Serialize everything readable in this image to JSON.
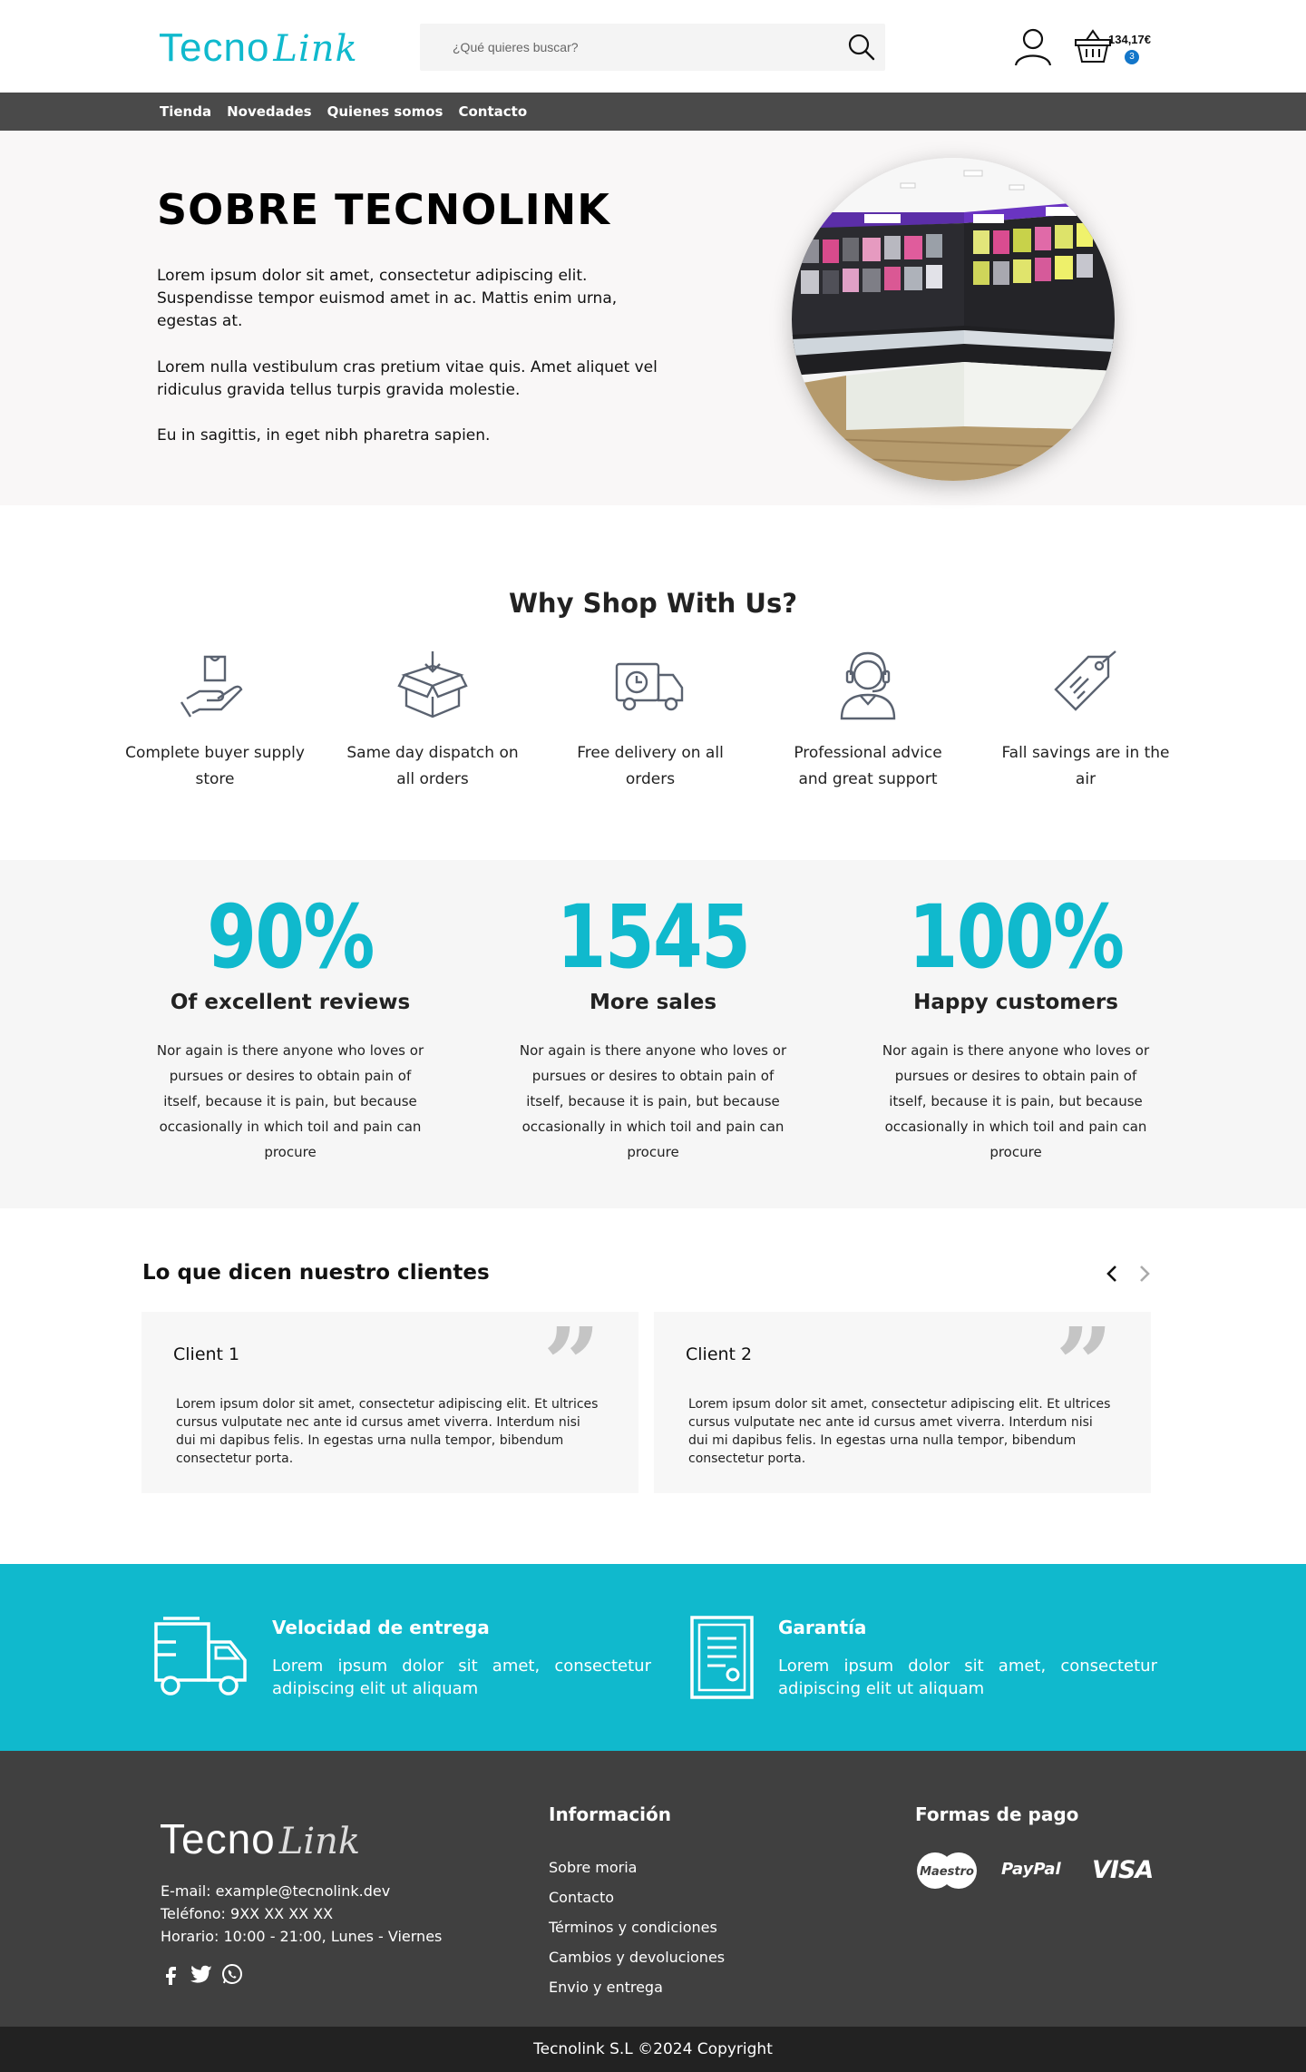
{
  "brand": {
    "logo_part1": "Tecno",
    "logo_part2": "Link",
    "accent_color": "#10b9cd"
  },
  "search": {
    "placeholder": "¿Qué quieres buscar?",
    "icon": "search-icon"
  },
  "cart": {
    "total": "134,17€",
    "count": "3",
    "icon": "basket-icon"
  },
  "account": {
    "icon": "user-icon"
  },
  "nav": {
    "items": [
      "Tienda",
      "Novedades",
      "Quienes somos",
      "Contacto"
    ]
  },
  "about": {
    "title": "SOBRE TECNOLINK",
    "paragraphs": [
      "Lorem ipsum dolor sit amet, consectetur adipiscing elit. Suspendisse tempor euismod amet in ac. Mattis enim urna, egestas at.",
      "Lorem nulla vestibulum cras pretium vitae quis. Amet aliquet vel ridiculus gravida tellus turpis gravida molestie.",
      "Eu in sagittis, in eget nibh pharetra sapien."
    ],
    "image": "store-interior-photo"
  },
  "why": {
    "title": "Why Shop With Us?",
    "features": [
      {
        "icon": "hand-bag-icon",
        "text": "Complete buyer supply store"
      },
      {
        "icon": "box-download-icon",
        "text": "Same day dispatch on all orders"
      },
      {
        "icon": "delivery-truck-icon",
        "text": "Free delivery on all orders"
      },
      {
        "icon": "support-agent-icon",
        "text": "Professional advice and great support"
      },
      {
        "icon": "price-tag-icon",
        "text": "Fall savings are in the air"
      }
    ]
  },
  "stats": [
    {
      "number": "90%",
      "label": "Of excellent reviews",
      "desc": "Nor again is there anyone who loves or pursues or desires to obtain pain of itself, because it is pain, but because occasionally in which toil and pain can procure"
    },
    {
      "number": "1545",
      "label": "More sales",
      "desc": "Nor again is there anyone who loves or pursues or desires to obtain pain of itself, because it is pain, but because occasionally in which toil and pain can procure"
    },
    {
      "number": "100%",
      "label": "Happy customers",
      "desc": "Nor again is there anyone who loves or pursues or desires to obtain pain of itself, because it is pain, but because occasionally in which toil and pain can procure"
    }
  ],
  "testimonials": {
    "title": "Lo que dicen nuestro clientes",
    "prev_icon": "chevron-left-icon",
    "next_icon": "chevron-right-icon",
    "items": [
      {
        "name": "Client 1",
        "quote_mark": "”",
        "text": "Lorem ipsum dolor sit amet, consectetur adipiscing elit. Et ultrices cursus vulputate nec ante id cursus amet viverra. Interdum nisi dui mi dapibus felis. In egestas urna nulla tempor, bibendum consectetur porta."
      },
      {
        "name": "Client 2",
        "quote_mark": "”",
        "text": "Lorem ipsum dolor sit amet, consectetur adipiscing elit. Et ultrices cursus vulputate nec ante id cursus amet viverra. Interdum nisi dui mi dapibus felis. In egestas urna nulla tempor, bibendum consectetur porta."
      }
    ]
  },
  "benefits": [
    {
      "icon": "delivery-truck-icon",
      "title": "Velocidad de entrega",
      "text": "Lorem ipsum dolor sit amet, consectetur adipiscing elit ut aliquam"
    },
    {
      "icon": "certificate-icon",
      "title": "Garantía",
      "text": "Lorem ipsum dolor sit amet, consectetur adipiscing elit ut aliquam"
    }
  ],
  "footer": {
    "email": "E-mail: example@tecnolink.dev",
    "phone": "Teléfono: 9XX XX XX XX",
    "hours": "Horario: 10:00 - 21:00, Lunes - Viernes",
    "social": [
      "facebook-icon",
      "twitter-icon",
      "whatsapp-icon"
    ],
    "info_title": "Información",
    "info_links": [
      "Sobre moria",
      "Contacto",
      "Términos y condiciones",
      "Cambios y devoluciones",
      "Envio y entrega"
    ],
    "payment_title": "Formas de pago",
    "payment_methods": [
      "Maestro",
      "PayPal",
      "VISA"
    ],
    "copyright": "Tecnolink S.L ©2024 Copyright"
  }
}
